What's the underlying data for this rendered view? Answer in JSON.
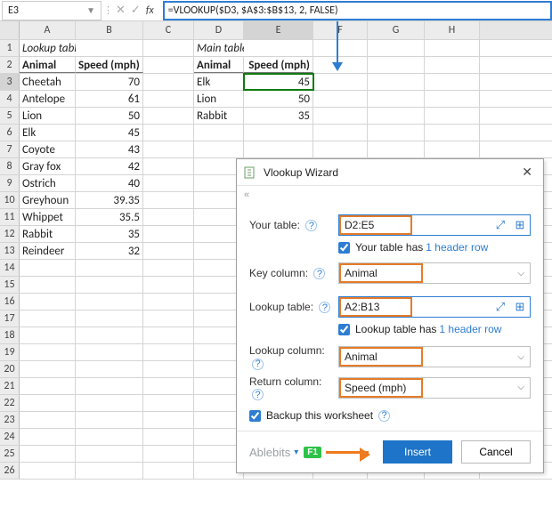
{
  "namebox": "E3",
  "formula": "=VLOOKUP($D3, $A$3:$B$13, 2, FALSE)",
  "cols": [
    "A",
    "B",
    "C",
    "D",
    "E",
    "F",
    "G",
    "H"
  ],
  "lookup_title": "Lookup table",
  "main_title": "Main table",
  "headers": {
    "animal": "Animal",
    "speed": "Speed (mph)"
  },
  "lookup": [
    {
      "a": "Cheetah",
      "b": "70"
    },
    {
      "a": "Antelope",
      "b": "61"
    },
    {
      "a": "Lion",
      "b": "50"
    },
    {
      "a": "Elk",
      "b": "45"
    },
    {
      "a": "Coyote",
      "b": "43"
    },
    {
      "a": "Gray fox",
      "b": "42"
    },
    {
      "a": "Ostrich",
      "b": "40"
    },
    {
      "a": "Greyhoun",
      "b": "39.35"
    },
    {
      "a": "Whippet",
      "b": "35.5"
    },
    {
      "a": "Rabbit",
      "b": "35"
    },
    {
      "a": "Reindeer",
      "b": "32"
    }
  ],
  "main": [
    {
      "d": "Elk",
      "e": "45"
    },
    {
      "d": "Lion",
      "e": "50"
    },
    {
      "d": "Rabbit",
      "e": "35"
    }
  ],
  "wizard": {
    "title": "Vlookup Wizard",
    "your_table_label": "Your table:",
    "your_table_val": "D2:E5",
    "your_table_chk": "Your table has",
    "header_row_link": "1 header row",
    "key_col_label": "Key column:",
    "key_col_val": "Animal",
    "lookup_table_label": "Lookup table:",
    "lookup_table_val": "A2:B13",
    "lookup_table_chk": "Lookup table has",
    "lookup_col_label": "Lookup column:",
    "lookup_col_val": "Animal",
    "return_col_label": "Return column:",
    "return_col_val": "Speed (mph)",
    "backup_label": "Backup this worksheet",
    "brand": "Ablebits",
    "f1": "F1",
    "insert": "Insert",
    "cancel": "Cancel"
  }
}
